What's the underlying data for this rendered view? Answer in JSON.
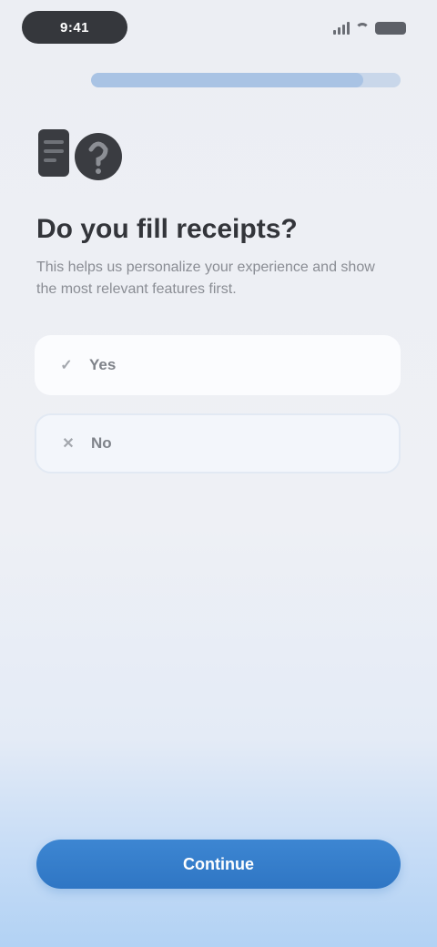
{
  "status_bar": {
    "time": "9:41"
  },
  "onboarding": {
    "progress_fraction": 0.88,
    "question_title": "Do you fill receipts?",
    "question_subtitle": "This helps us personalize your experience and show the most relevant features first."
  },
  "options": [
    {
      "label": "Yes",
      "icon": "check-icon"
    },
    {
      "label": "No",
      "icon": "close-icon"
    }
  ],
  "footer": {
    "continue_label": "Continue"
  },
  "colors": {
    "accent": "#2f76c4",
    "progress_fill": "#a9c3e4",
    "card": "#fbfcfe"
  }
}
